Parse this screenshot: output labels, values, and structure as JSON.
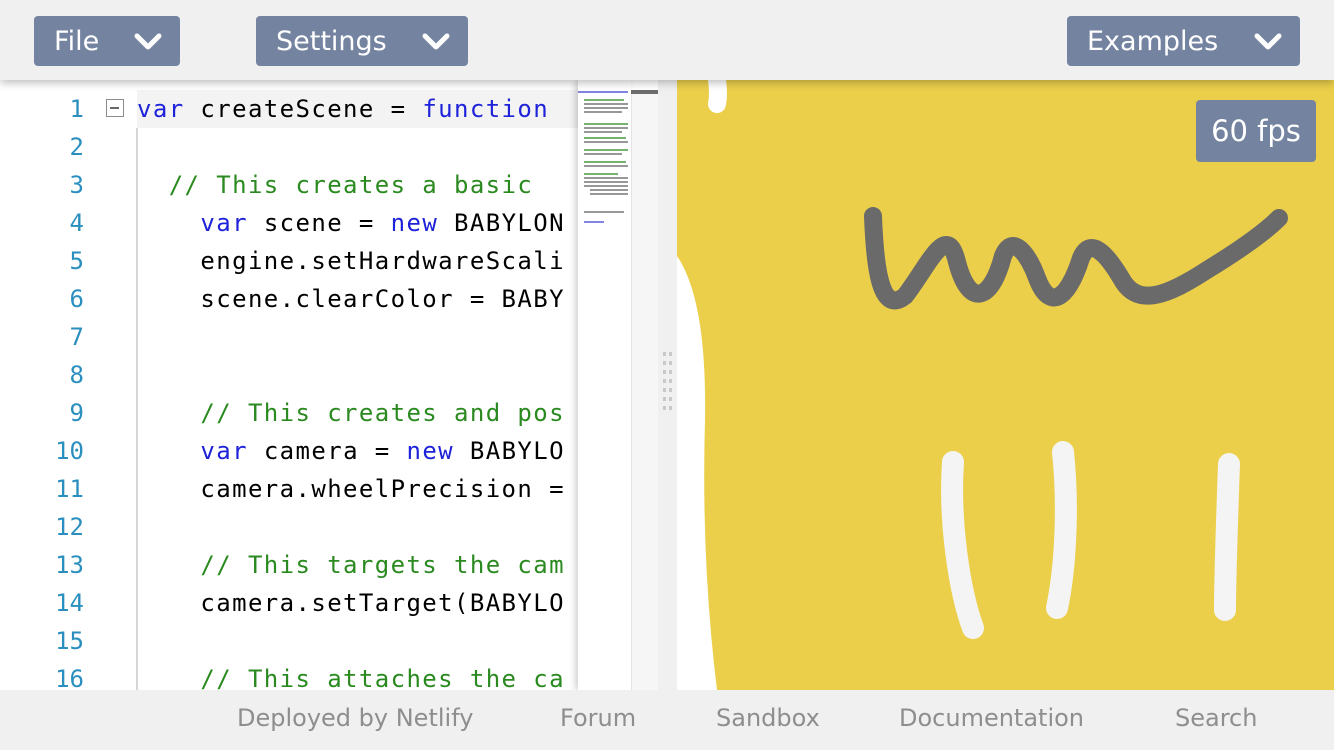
{
  "toolbar": {
    "file_label": "File",
    "settings_label": "Settings",
    "examples_label": "Examples",
    "button_color": "#7383a0"
  },
  "editor": {
    "lines": [
      {
        "num": "1"
      },
      {
        "num": "2"
      },
      {
        "num": "3"
      },
      {
        "num": "4"
      },
      {
        "num": "5"
      },
      {
        "num": "6"
      },
      {
        "num": "7"
      },
      {
        "num": "8"
      },
      {
        "num": "9"
      },
      {
        "num": "10"
      },
      {
        "num": "11"
      },
      {
        "num": "12"
      },
      {
        "num": "13"
      },
      {
        "num": "14"
      },
      {
        "num": "15"
      },
      {
        "num": "16"
      }
    ],
    "code": {
      "l1_kw": "var",
      "l1_rest": " createScene = ",
      "l1_kw2": "function",
      "l3": "// This creates a basic",
      "l4_kw": "var",
      "l4_mid": " scene = ",
      "l4_kw2": "new",
      "l4_rest": " BABYLON",
      "l5": "engine.setHardwareScali",
      "l6": "scene.clearColor = BABY",
      "l9": "// This creates and pos",
      "l10_kw": "var",
      "l10_mid": " camera = ",
      "l10_kw2": "new",
      "l10_rest": " BABYLO",
      "l11": "camera.wheelPrecision =",
      "l13": "// This targets the cam",
      "l14": "camera.setTarget(BABYLO",
      "l16": "// This attaches the ca"
    },
    "keyword_color": "#1e22d8",
    "comment_color": "#2a8a1f",
    "line_number_color": "#2a8fbf"
  },
  "render": {
    "fps_label": "60 fps",
    "background_color": "#ebcf4b"
  },
  "footer": {
    "links": [
      "Deployed by Netlify",
      "Forum",
      "Sandbox",
      "Documentation",
      "Search"
    ]
  }
}
